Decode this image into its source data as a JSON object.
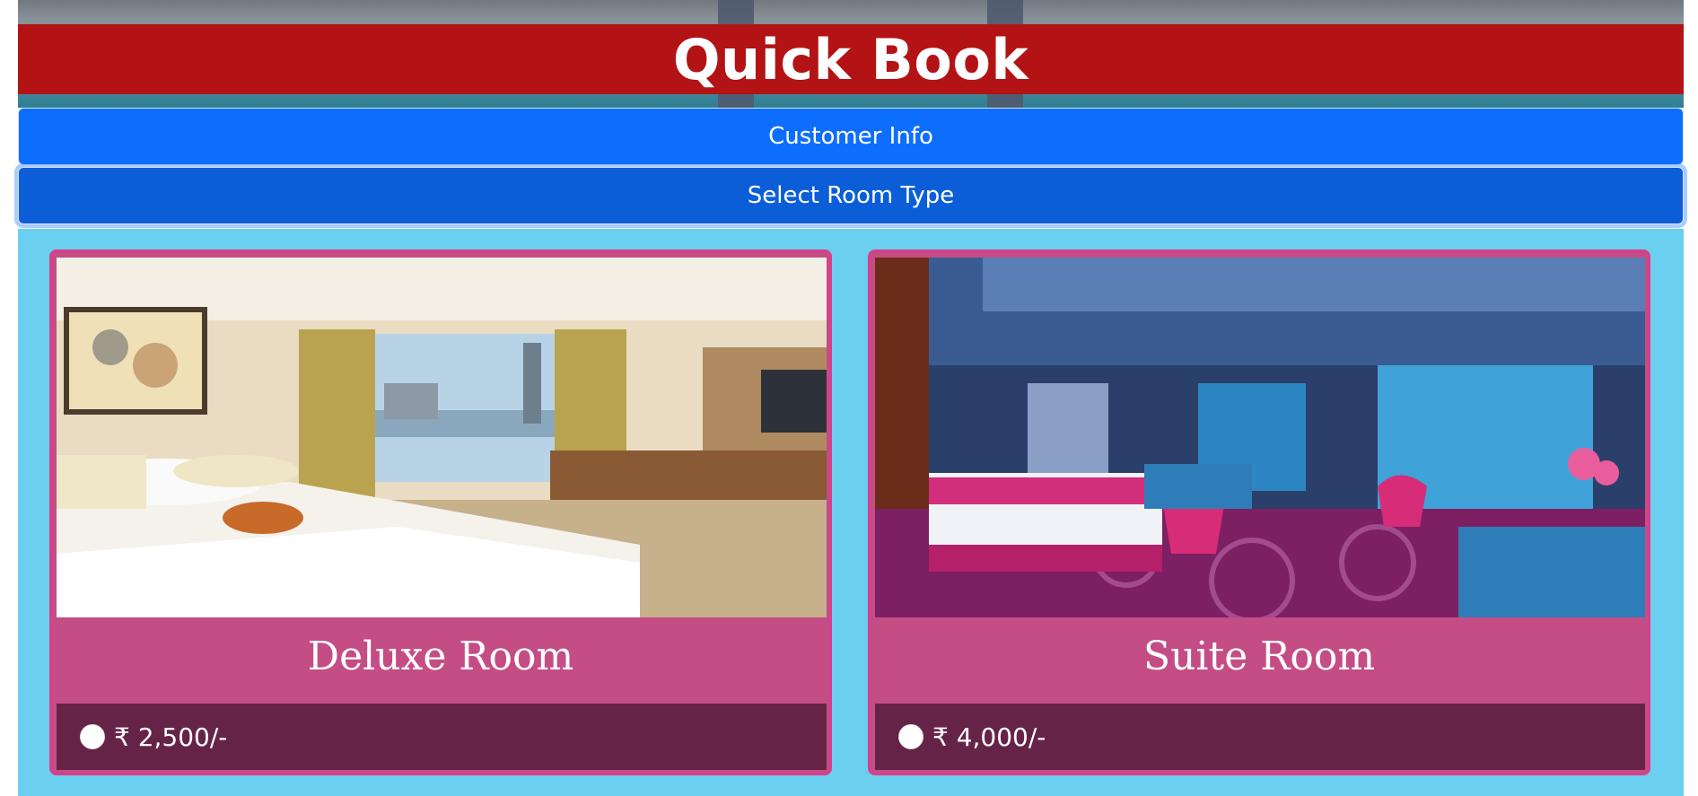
{
  "header": {
    "title": "Quick Book"
  },
  "accordion": {
    "customer_info_label": "Customer Info",
    "room_type_label": "Select Room Type"
  },
  "rooms": [
    {
      "name": "Deluxe Room",
      "price": "₹ 2,500/-"
    },
    {
      "name": "Suite Room",
      "price": "₹ 4,000/-"
    }
  ],
  "colors": {
    "title_bar": "#b31315",
    "accordion_button": "#0d6efd",
    "panel_background": "#6bcfef",
    "card_background": "#c44d86",
    "card_footer": "#652447"
  }
}
